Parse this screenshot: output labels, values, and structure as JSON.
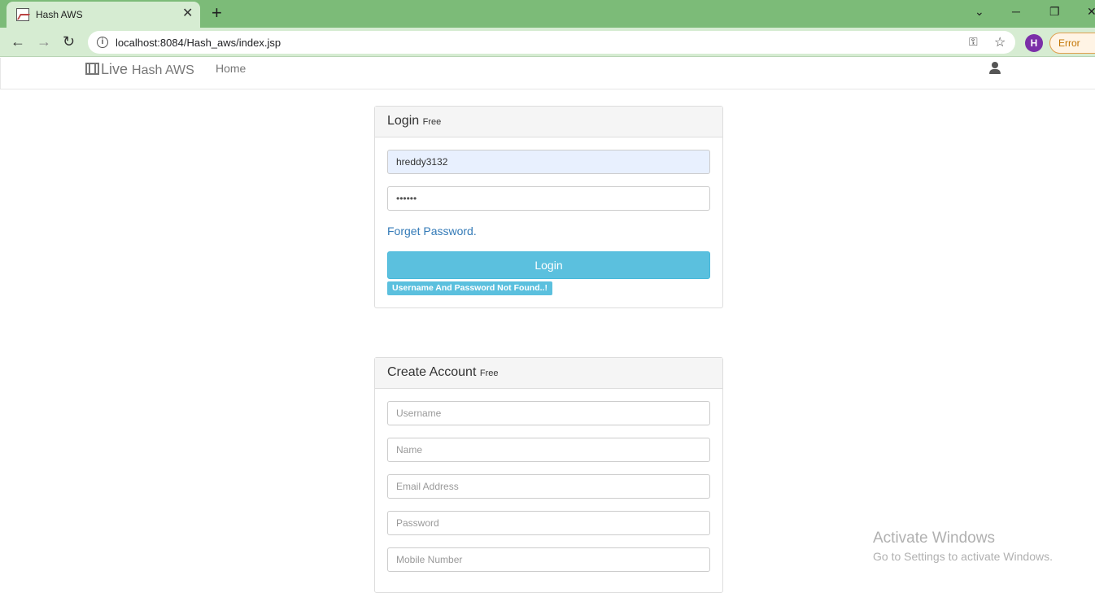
{
  "browser": {
    "tab_title": "Hash AWS",
    "url": "localhost:8084/Hash_aws/index.jsp",
    "profile_initial": "H",
    "error_label": "Error"
  },
  "navbar": {
    "brand": "Live",
    "brand_sub": "Hash AWS",
    "home": "Home"
  },
  "login": {
    "title": "Login",
    "title_small": "Free",
    "username_value": "hreddy3132",
    "password_value": "••••••",
    "forget_link": "Forget Password.",
    "button": "Login",
    "error_badge": "Username And Password Not Found..!"
  },
  "register": {
    "title": "Create Account",
    "title_small": "Free",
    "fields": [
      "Username",
      "Name",
      "Email Address",
      "Password",
      "Mobile Number"
    ]
  },
  "watermark": {
    "title": "Activate Windows",
    "subtitle": "Go to Settings to activate Windows."
  },
  "colors": {
    "tabbar": "#7cbb78",
    "toolbar": "#d6ecd2",
    "info_button": "#5bc0de",
    "link": "#337ab7"
  }
}
